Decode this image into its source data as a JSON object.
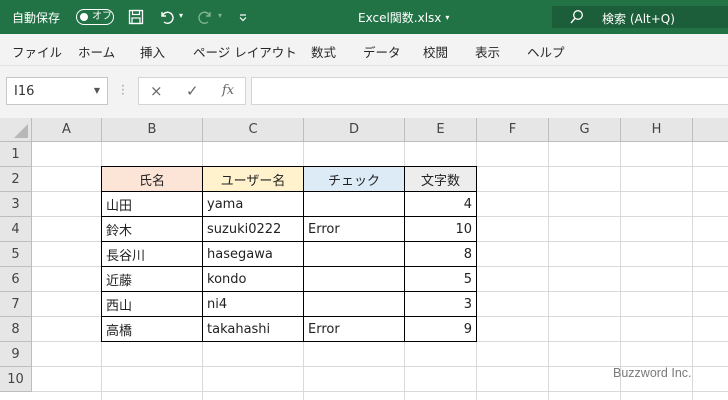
{
  "titlebar": {
    "autosave_label": "自動保存",
    "autosave_state": "オフ",
    "document_title": "Excel関数.xlsx",
    "search_placeholder": "検索 (Alt+Q)"
  },
  "ribbon": {
    "tabs": [
      "ファイル",
      "ホーム",
      "挿入",
      "ページ レイアウト",
      "数式",
      "データ",
      "校閲",
      "表示",
      "ヘルプ"
    ]
  },
  "formula_bar": {
    "name_box": "I16",
    "cancel_icon": "×",
    "enter_icon": "✓",
    "fx_label": "fx",
    "formula": ""
  },
  "sheet": {
    "columns": [
      "A",
      "B",
      "C",
      "D",
      "E",
      "F",
      "G",
      "H"
    ],
    "rows": [
      "1",
      "2",
      "3",
      "4",
      "5",
      "6",
      "7",
      "8",
      "9",
      "10"
    ],
    "table": {
      "headers": [
        "氏名",
        "ユーザー名",
        "チェック",
        "文字数"
      ],
      "header_colors": [
        "#fce4d6",
        "#fff2cc",
        "#ddebf7",
        "#ededed"
      ],
      "rows": [
        [
          "山田",
          "yama",
          "",
          "4"
        ],
        [
          "鈴木",
          "suzuki0222",
          "Error",
          "10"
        ],
        [
          "長谷川",
          "hasegawa",
          "",
          "8"
        ],
        [
          "近藤",
          "kondo",
          "",
          "5"
        ],
        [
          "西山",
          "ni4",
          "",
          "3"
        ],
        [
          "高橋",
          "takahashi",
          "Error",
          "9"
        ]
      ]
    }
  },
  "watermark": "Buzzword Inc.",
  "colors": {
    "title_bar": "#217346",
    "search_bg": "#1b5e39",
    "ribbon_bg": "#f3f3f3"
  }
}
